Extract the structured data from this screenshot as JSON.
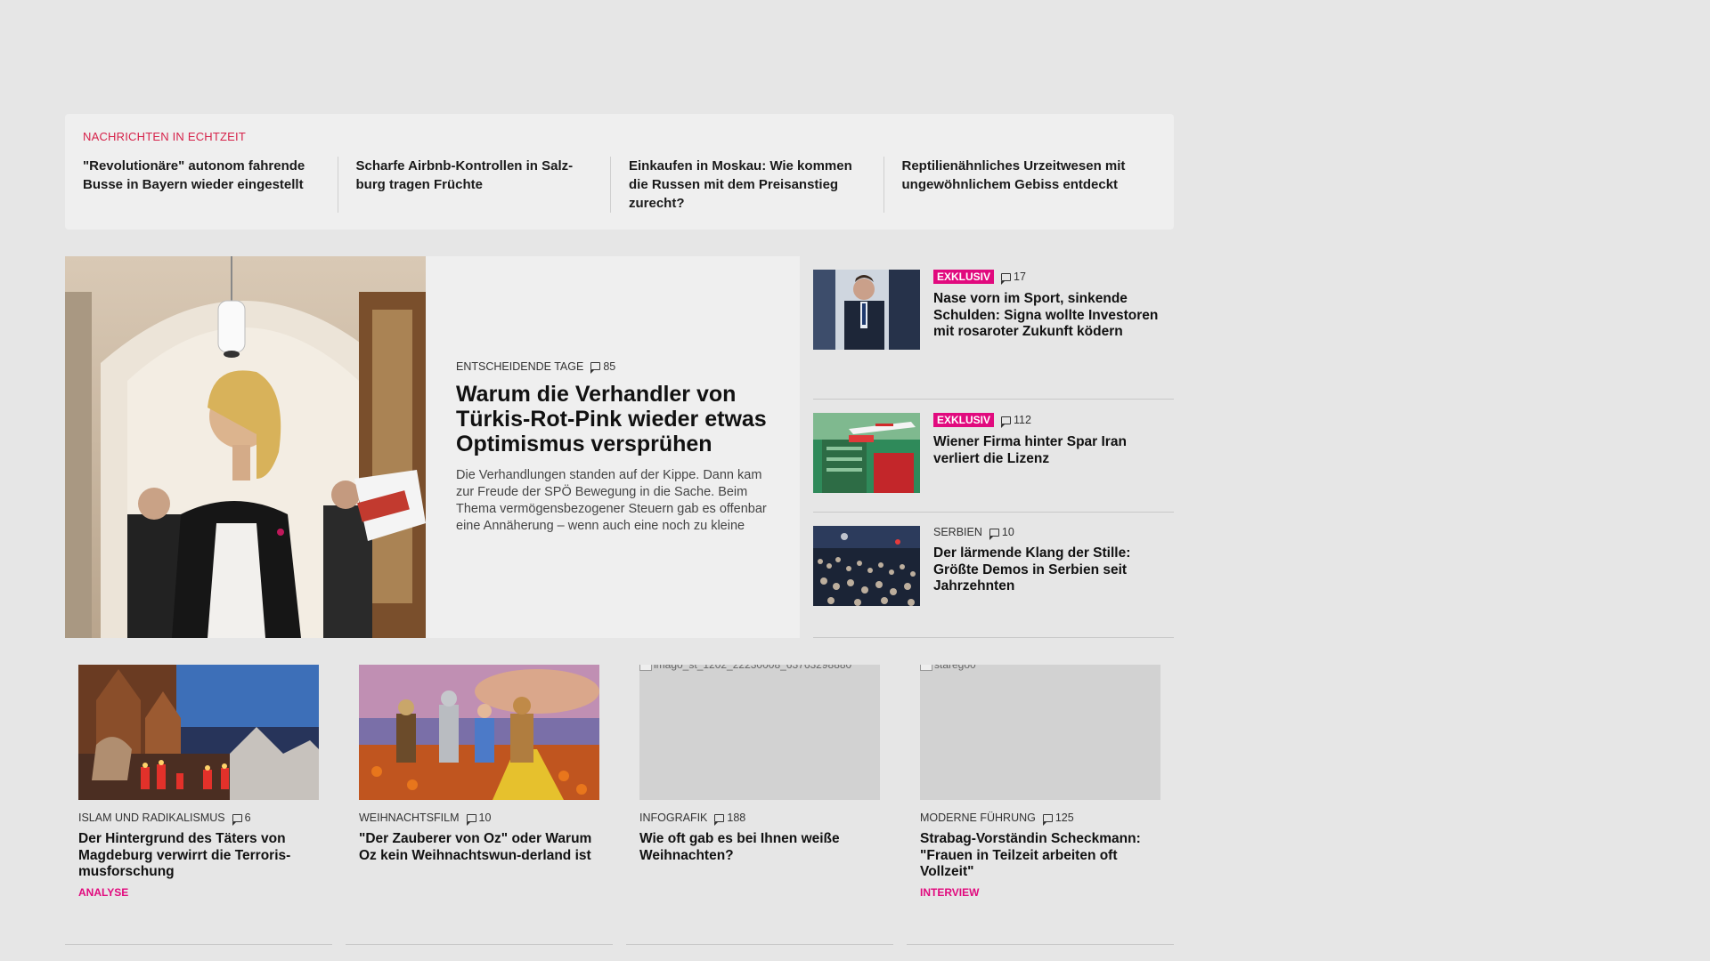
{
  "ticker": {
    "label": "NACHRICHTEN IN ECHTZEIT",
    "items": [
      "\"Revolutionäre\" autonom fahrende Busse in Bayern wieder eingestellt",
      "Scharfe Airbnb-Kontrollen in Salz-burg tragen Früchte",
      "Einkaufen in Moskau: Wie kommen die Russen mit dem Preisanstieg zurecht?",
      "Reptilienähnliches Urzeitwesen mit ungewöhnlichem Gebiss entdeckt"
    ]
  },
  "lead": {
    "kicker": "ENTSCHEIDENDE TAGE",
    "comments": "85",
    "title": "Warum die Verhandler von Türkis-Rot-Pink wieder etwas Optimismus versprühen",
    "teaser": "Die Verhandlungen standen auf der Kippe. Dann kam zur Freude der SPÖ Bewegung in die Sache. Beim Thema vermögensbezogener Steuern gab es offenbar eine Annäherung – wenn auch eine noch zu kleine"
  },
  "side": [
    {
      "badge": "EXKLUSIV",
      "comments": "17",
      "title": "Nase vorn im Sport, sinkende Schulden: Signa wollte Investoren mit rosaroter Zukunft ködern"
    },
    {
      "badge": "EXKLUSIV",
      "comments": "112",
      "title": "Wiener Firma hinter Spar Iran verliert die Lizenz"
    },
    {
      "kicker": "SERBIEN",
      "comments": "10",
      "title": "Der lärmende Klang der Stille: Größte Demos in Serbien seit Jahrzehnten"
    }
  ],
  "cards": [
    {
      "kicker": "ISLAM UND RADIKALISMUS",
      "comments": "6",
      "title": "Der Hintergrund des Täters von Magdeburg verwirrt die Terroris-musforschung",
      "tag": "ANALYSE"
    },
    {
      "kicker": "WEIHNACHTSFILM",
      "comments": "10",
      "title": "\"Der Zauberer von Oz\" oder Warum Oz kein Weihnachtswun-derland ist",
      "tag": ""
    },
    {
      "kicker": "INFOGRAFIK",
      "comments": "188",
      "title": "Wie oft gab es bei Ihnen weiße Weihnachten?",
      "tag": "",
      "img_alt": "imago_st_1202_22230008_63763298880"
    },
    {
      "kicker": "MODERNE FÜHRUNG",
      "comments": "125",
      "title": "Strabag-Vorständin Scheckmann: \"Frauen in Teilzeit arbeiten oft Vollzeit\"",
      "tag": "INTERVIEW",
      "img_alt": "starego0"
    }
  ],
  "colors": {
    "accent": "#e10a7e",
    "ticker_label": "#d6224a",
    "background": "#e6e6e6"
  }
}
